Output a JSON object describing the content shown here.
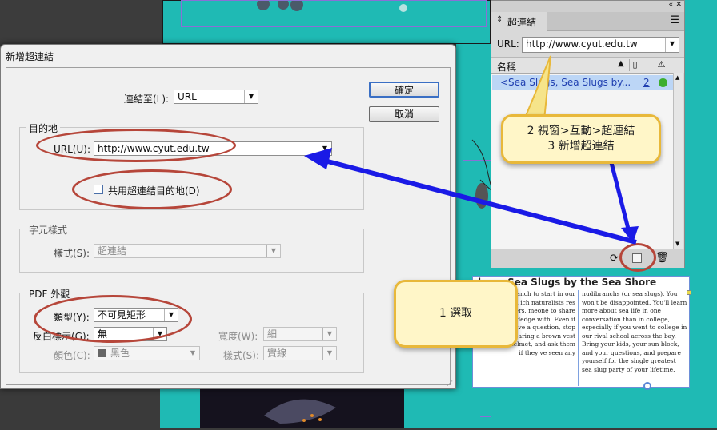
{
  "dialog": {
    "title": "新增超連結",
    "link_to_label": "連結至(L):",
    "link_to_value": "URL",
    "ok_label": "確定",
    "cancel_label": "取消",
    "destination": {
      "group_title": "目的地",
      "url_label": "URL(U):",
      "url_value": "http://www.cyut.edu.tw",
      "shared_label": "共用超連結目的地(D)",
      "shared_checked": false
    },
    "char_style": {
      "group_title": "字元樣式",
      "style_label": "樣式(S):",
      "style_value": "超連結"
    },
    "pdf": {
      "group_title": "PDF 外觀",
      "type_label": "類型(Y):",
      "type_value": "不可見矩形",
      "highlight_label": "反白標示(G):",
      "highlight_value": "無",
      "color_label": "顏色(C):",
      "color_value": "黑色",
      "width_label": "寬度(W):",
      "width_value": "細",
      "style_label": "樣式(S):",
      "style_value": "實線"
    }
  },
  "panel": {
    "title": "超連結",
    "url_label": "URL:",
    "url_value": "http://www.cyut.edu.tw",
    "name_header": "名稱",
    "row_name": "<Sea Slugs, Sea Slugs by...",
    "row_page": "2",
    "status_color": "#3cae2e"
  },
  "article": {
    "title": "lugs, Sea Slugs by the Sea Shore",
    "col1": "al Nudibranch to start in our munity. We'll ich naturalists res of our waters, meone to share their knowledge with. Even if you don't have a question, stop anyone wearing a brown vest and pith helmet, and ask them if they've seen any",
    "col2": "nudibranchs (or sea slugs). You won't be disappointed. You'll learn more about sea life in one conversation than in college, especially if you went to college in our rival school across the bay. Bring your kids, your sun block, and your questions, and prepare yourself for the single greatest sea slug party of your lifetime."
  },
  "callouts": {
    "menu_line1": "2 視窗>互動>超連結",
    "menu_line2": "3 新增超連結",
    "select": "1 選取"
  },
  "colors": {
    "annotation_red": "#b6463a",
    "arrow_blue": "#1a1ae6",
    "callout_fill": "#fff6c8",
    "callout_border": "#e8b83a",
    "page_teal": "#1fbab4"
  }
}
